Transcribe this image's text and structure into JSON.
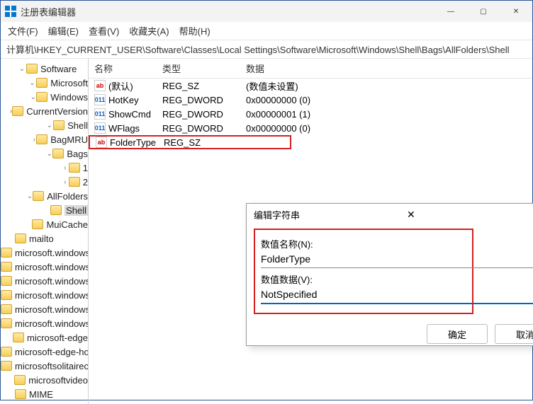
{
  "window": {
    "title": "注册表编辑器"
  },
  "menu": {
    "file": "文件(F)",
    "edit": "编辑(E)",
    "view": "查看(V)",
    "favorites": "收藏夹(A)",
    "help": "帮助(H)"
  },
  "address": "计算机\\HKEY_CURRENT_USER\\Software\\Classes\\Local Settings\\Software\\Microsoft\\Windows\\Shell\\Bags\\AllFolders\\Shell",
  "tree": [
    {
      "depth": 1,
      "expand": "open",
      "label": "Software"
    },
    {
      "depth": 2,
      "expand": "open",
      "label": "Microsoft"
    },
    {
      "depth": 3,
      "expand": "open",
      "label": "Windows"
    },
    {
      "depth": 4,
      "expand": "closed",
      "label": "CurrentVersion"
    },
    {
      "depth": 4,
      "expand": "open",
      "label": "Shell"
    },
    {
      "depth": 5,
      "expand": "closed",
      "label": "BagMRU"
    },
    {
      "depth": 5,
      "expand": "open",
      "label": "Bags"
    },
    {
      "depth": 6,
      "expand": "closed",
      "label": "1"
    },
    {
      "depth": 6,
      "expand": "closed",
      "label": "2"
    },
    {
      "depth": 6,
      "expand": "open",
      "label": "AllFolders"
    },
    {
      "depth": 7,
      "expand": "none",
      "label": "Shell",
      "selected": true
    },
    {
      "depth": 5,
      "expand": "none",
      "label": "MuiCache"
    },
    {
      "depth": 0,
      "expand": "none",
      "label": "mailto"
    },
    {
      "depth": 0,
      "expand": "none",
      "label": "microsoft.windows.camera"
    },
    {
      "depth": 0,
      "expand": "none",
      "label": "microsoft.windows.camera.m"
    },
    {
      "depth": 0,
      "expand": "none",
      "label": "microsoft.windows.camera.pi"
    },
    {
      "depth": 0,
      "expand": "none",
      "label": "microsoft.windows.photos.cro"
    },
    {
      "depth": 0,
      "expand": "none",
      "label": "microsoft.windows.photos.pic"
    },
    {
      "depth": 0,
      "expand": "none",
      "label": "microsoft.windows.photos.vic"
    },
    {
      "depth": 0,
      "expand": "none",
      "label": "microsoft-edge"
    },
    {
      "depth": 0,
      "expand": "none",
      "label": "microsoft-edge-holographic"
    },
    {
      "depth": 0,
      "expand": "none",
      "label": "microsoftsolitairecollection"
    },
    {
      "depth": 0,
      "expand": "none",
      "label": "microsoftvideo"
    },
    {
      "depth": 0,
      "expand": "none",
      "label": "MIME"
    }
  ],
  "columns": {
    "name": "名称",
    "type": "类型",
    "data": "数据"
  },
  "values": [
    {
      "icon": "ab",
      "name": "(默认)",
      "type": "REG_SZ",
      "data": "(数值未设置)"
    },
    {
      "icon": "bin",
      "name": "HotKey",
      "type": "REG_DWORD",
      "data": "0x00000000 (0)"
    },
    {
      "icon": "bin",
      "name": "ShowCmd",
      "type": "REG_DWORD",
      "data": "0x00000001 (1)"
    },
    {
      "icon": "bin",
      "name": "WFlags",
      "type": "REG_DWORD",
      "data": "0x00000000 (0)"
    },
    {
      "icon": "ab",
      "name": "FolderType",
      "type": "REG_SZ",
      "data": "",
      "highlight": true
    }
  ],
  "dialog": {
    "title": "编辑字符串",
    "name_label": "数值名称(N):",
    "name_value": "FolderType",
    "data_label": "数值数据(V):",
    "data_value": "NotSpecified",
    "ok": "确定",
    "cancel": "取消"
  }
}
